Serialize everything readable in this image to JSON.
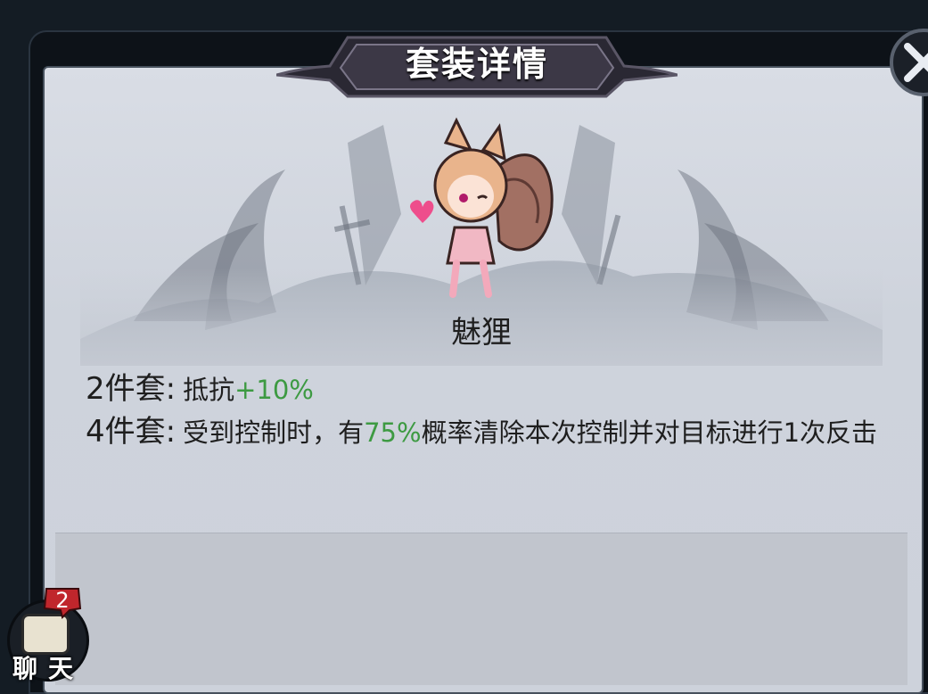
{
  "window": {
    "title": "套装详情"
  },
  "set": {
    "name": "魅狸",
    "bonuses": [
      {
        "label": "2件套:",
        "pre": "抵抗",
        "highlight": "+10%",
        "post": ""
      },
      {
        "label": "4件套:",
        "pre": "受到控制时，有",
        "highlight": "75%",
        "post": "概率清除本次控制并对目标进行1次反击"
      }
    ]
  },
  "chat": {
    "label": "聊天",
    "badge": "2"
  },
  "colors": {
    "highlight": "#3d9a42",
    "panel": "#d4d8e0",
    "frame": "#0d1218",
    "badge": "#c0262c"
  },
  "icons": {
    "close": "close-x-icon",
    "chat": "chat-bubble-icon"
  }
}
